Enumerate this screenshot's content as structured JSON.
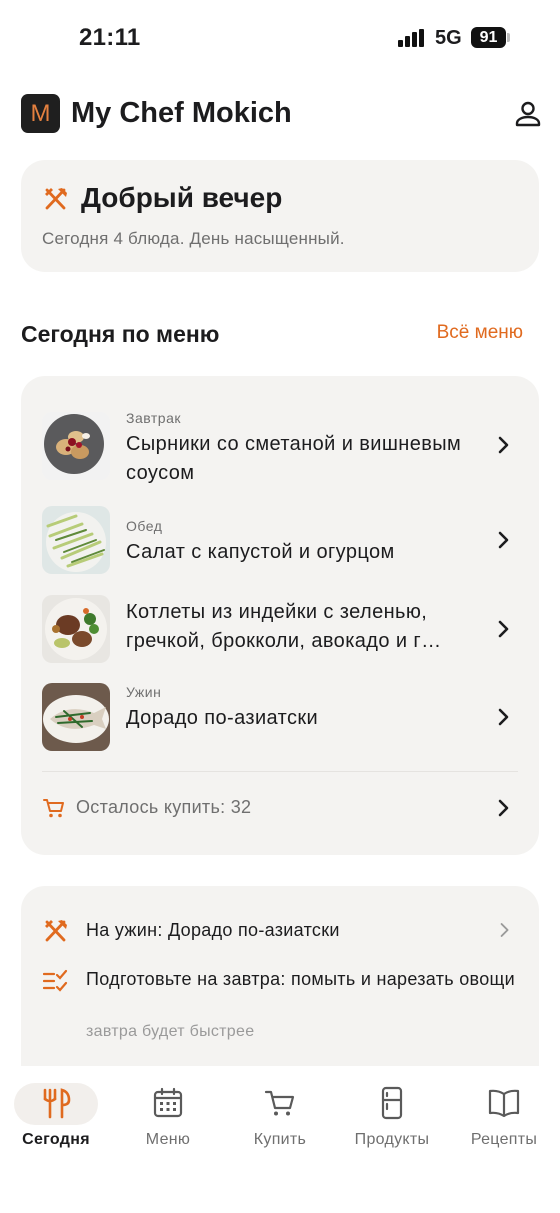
{
  "status_bar": {
    "time": "21:11",
    "network": "5G",
    "battery": "91"
  },
  "app": {
    "logo_letter": "M",
    "title": "My Chef Mokich"
  },
  "greeting": {
    "title": "Добрый вечер",
    "subtitle": "Сегодня 4 блюда. День насыщенный."
  },
  "today": {
    "title": "Сегодня по меню",
    "all_menu_link": "Всё меню",
    "meals": [
      {
        "type": "Завтрак",
        "name": "Сырники со сметаной и вишневым соусом",
        "image": "syrniki-photo"
      },
      {
        "type": "Обед",
        "name": "Салат с капустой и огурцом",
        "image": "salad-photo"
      },
      {
        "type": "",
        "name": "Котлеты из индейки с зеленью, гречкой, брокколи, авокадо и г…",
        "image": "cutlets-photo"
      },
      {
        "type": "Ужин",
        "name": "Дорадо по-азиатски",
        "image": "dorado-photo"
      }
    ],
    "shopping": {
      "text": "Осталось купить: 32",
      "icon": "cart-icon"
    }
  },
  "tips": {
    "dinner": {
      "text": "На ужин: Дорадо по-азиатски",
      "icon": "fork-knife-icon"
    },
    "prepare": {
      "text": "Подготовьте на завтра: помыть и нарезать овощи",
      "hint": "завтра будет быстрее",
      "icon": "checklist-icon"
    }
  },
  "tab_bar": {
    "tabs": [
      {
        "label": "Сегодня",
        "icon": "fork-spoon-icon",
        "active": true
      },
      {
        "label": "Меню",
        "icon": "calendar-icon",
        "active": false
      },
      {
        "label": "Купить",
        "icon": "cart-icon",
        "active": false
      },
      {
        "label": "Продукты",
        "icon": "fridge-icon",
        "active": false
      },
      {
        "label": "Рецепты",
        "icon": "book-icon",
        "active": false
      }
    ]
  },
  "colors": {
    "accent": "#e06a1f",
    "card": "#f4f3f1",
    "text": "#1c1c1e",
    "muted": "#6f6f6f"
  }
}
